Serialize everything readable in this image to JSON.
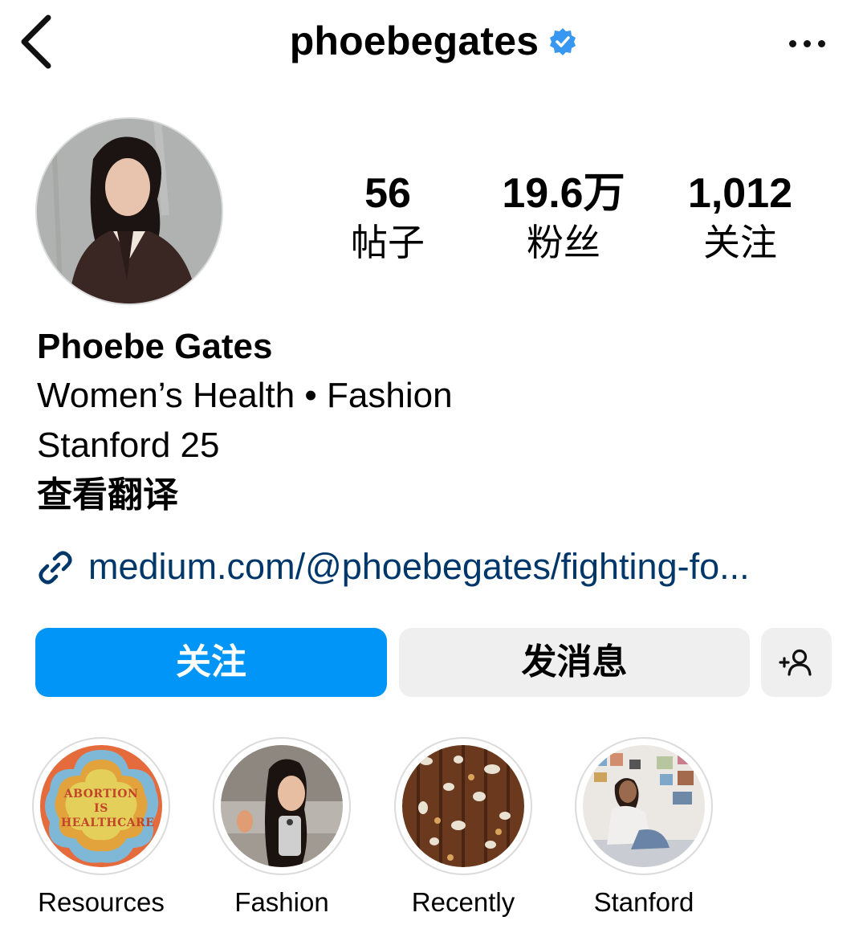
{
  "header": {
    "username": "phoebegates",
    "verified": true,
    "back_icon": "chevron-left-icon",
    "more_icon": "more-horizontal-icon",
    "accent_verified": "#3897f0"
  },
  "profile": {
    "stats": [
      {
        "value": "56",
        "label": "帖子"
      },
      {
        "value": "19.6万",
        "label": "粉丝"
      },
      {
        "value": "1,012",
        "label": "关注"
      }
    ],
    "name": "Phoebe Gates",
    "bio_lines": [
      "Women’s Health • Fashion",
      "Stanford 25"
    ],
    "translate_label": "查看翻译",
    "link": "medium.com/@phoebegates/fighting-fo..."
  },
  "actions": {
    "follow_label": "关注",
    "message_label": "发消息",
    "add_person_icon": "add-person-icon",
    "follow_color": "#0095f6",
    "secondary_color": "#efefef"
  },
  "highlights": [
    {
      "label": "Resources",
      "cover_text": "ABORTION IS HEALTHCARE"
    },
    {
      "label": "Fashion"
    },
    {
      "label": "Recently"
    },
    {
      "label": "Stanford"
    }
  ]
}
